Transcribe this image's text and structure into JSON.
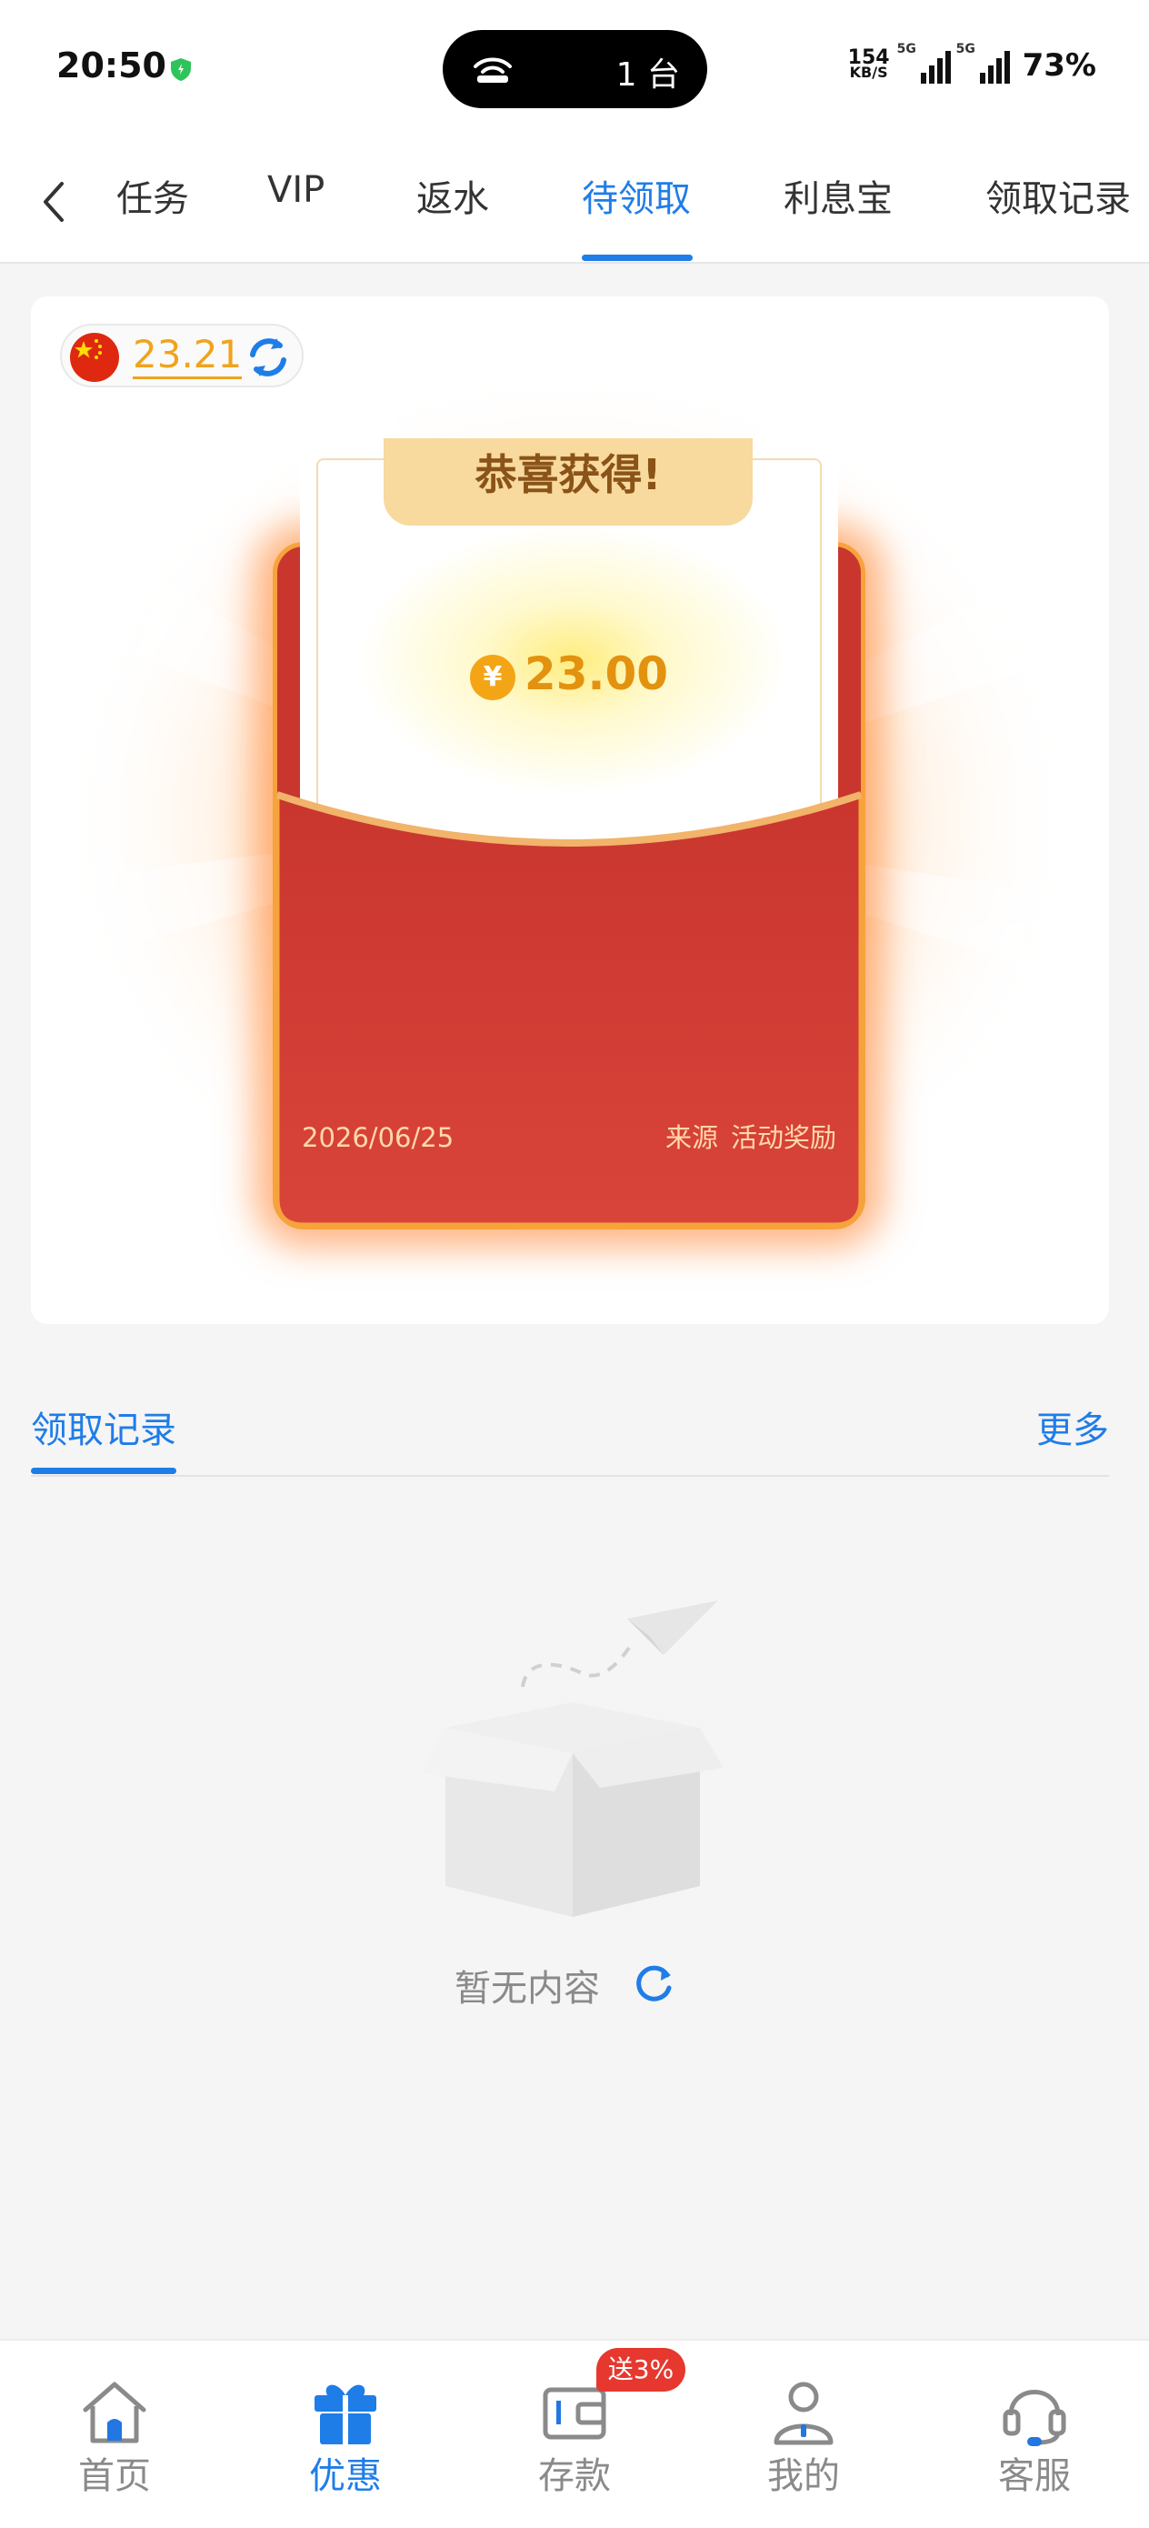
{
  "status_bar": {
    "time": "20:50",
    "island_count": "1 台",
    "net_speed": "154",
    "net_unit": "KB/S",
    "signal_tag_1": "5G",
    "signal_tag_2": "5G",
    "battery": "73%"
  },
  "top_nav": {
    "tabs": [
      {
        "label": "任务"
      },
      {
        "label": "VIP"
      },
      {
        "label": "返水"
      },
      {
        "label": "待领取"
      },
      {
        "label": "利息宝"
      },
      {
        "label": "领取记录"
      }
    ],
    "active_tab": "待领取"
  },
  "balance": {
    "value": "23.21",
    "currency_flag_icon": "china-flag-icon"
  },
  "red_packet": {
    "congrats": "恭喜获得!",
    "currency_symbol": "¥",
    "amount": "23.00",
    "date": "2026/06/25",
    "source_label": "来源",
    "source_value": "活动奖励"
  },
  "records": {
    "tab_label": "领取记录",
    "more_label": "更多",
    "empty_text": "暂无内容"
  },
  "bottom_nav": {
    "items": [
      {
        "label": "首页",
        "icon": "home-icon"
      },
      {
        "label": "优惠",
        "icon": "gift-icon"
      },
      {
        "label": "存款",
        "icon": "wallet-icon"
      },
      {
        "label": "我的",
        "icon": "user-icon"
      },
      {
        "label": "客服",
        "icon": "headset-icon"
      }
    ],
    "promo_badge": "送3%",
    "active_index": 1
  },
  "colors": {
    "accent": "#1f7de8",
    "gold": "#f0a31c",
    "envelope_red": "#c9362e",
    "badge_red": "#e6382e"
  }
}
